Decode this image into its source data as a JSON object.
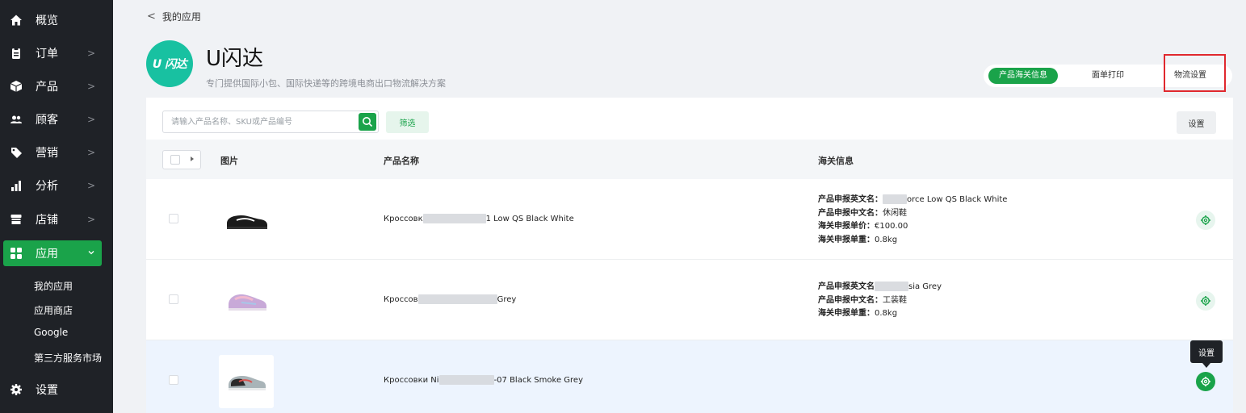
{
  "sidebar": {
    "items": [
      {
        "label": "概览",
        "icon": "home-icon"
      },
      {
        "label": "订单",
        "icon": "clipboard-icon"
      },
      {
        "label": "产品",
        "icon": "box-icon"
      },
      {
        "label": "顾客",
        "icon": "users-icon"
      },
      {
        "label": "营销",
        "icon": "tag-icon"
      },
      {
        "label": "分析",
        "icon": "bar-chart-icon"
      },
      {
        "label": "店铺",
        "icon": "store-icon"
      },
      {
        "label": "应用",
        "icon": "apps-grid-icon"
      }
    ],
    "sub_items": [
      "我的应用",
      "应用商店",
      "Google",
      "第三方服务市场"
    ],
    "settings_label": "设置",
    "active_color": "#1aa34a"
  },
  "header": {
    "back_label": "我的应用",
    "app_title": "U闪达",
    "logo_text": "U 闪达",
    "app_description": "专门提供国际小包、国际快递等的跨境电商出口物流解决方案"
  },
  "tabs": [
    "产品海关信息",
    "面单打印",
    "物流设置"
  ],
  "toolbar": {
    "search_placeholder": "请输入产品名称、SKU或产品编号",
    "filter_label": "筛选",
    "settings_label": "设置"
  },
  "table": {
    "columns": [
      "图片",
      "产品名称",
      "海关信息"
    ],
    "rows": [
      {
        "name_start": "Кроссовк",
        "name_end": "1 Low QS Black White",
        "customs": [
          {
            "label": "产品申报英文名：",
            "value": "orce Low QS Black White"
          },
          {
            "label": "产品申报中文名：",
            "value": "休闲鞋"
          },
          {
            "label": "海关申报单价：",
            "value": "€100.00"
          },
          {
            "label": "海关申报单重：",
            "value": "0.8kg"
          }
        ]
      },
      {
        "name_start": "Кроссов",
        "name_end": "Grey",
        "customs": [
          {
            "label": "产品申报英文名",
            "value": "sia Grey"
          },
          {
            "label": "产品申报中文名：",
            "value": "工装鞋"
          },
          {
            "label": "海关申报单重：",
            "value": "0.8kg"
          }
        ]
      },
      {
        "name_start": "Кроссовки Ni",
        "name_end": "-07 Black Smoke Grey",
        "customs": []
      }
    ]
  },
  "tooltip": "设置",
  "colors": {
    "brand_green": "#1aa34a",
    "logo_teal": "#18c1a1",
    "highlight_red": "#e0282e"
  }
}
